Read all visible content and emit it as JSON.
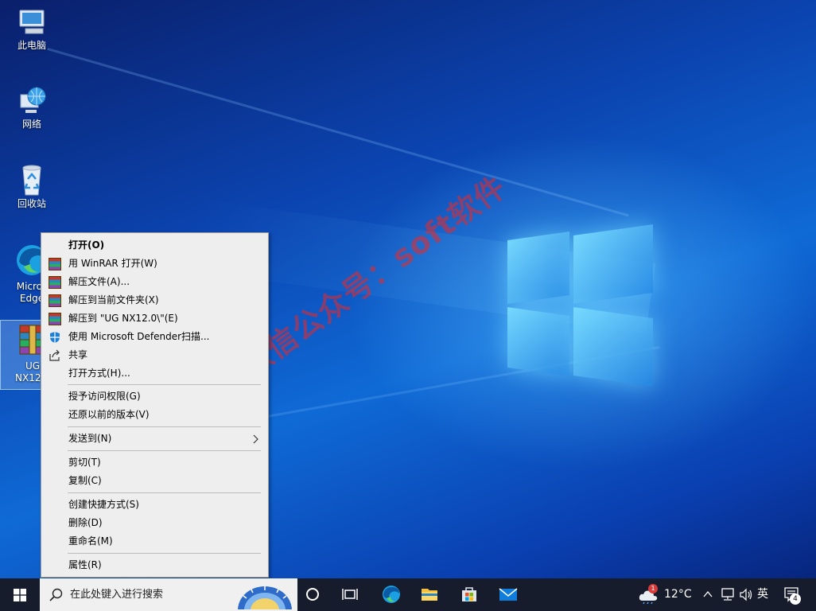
{
  "desktop": {
    "icons": [
      {
        "label": "此电脑",
        "icon": "computer-icon"
      },
      {
        "label": "网络",
        "icon": "network-globe-icon"
      },
      {
        "label": "回收站",
        "icon": "recycle-bin-icon"
      },
      {
        "label": "Micros\nEdge",
        "label_line1": "Micros",
        "label_line2": "Edge",
        "icon": "edge-browser-icon"
      },
      {
        "label_line1": "UG",
        "label_line2": "NX12.0",
        "icon": "winrar-archive-icon"
      }
    ],
    "watermark": "微信公众号：soft软件"
  },
  "context_menu": {
    "items": [
      {
        "label": "打开(O)",
        "bold": true,
        "icon": ""
      },
      {
        "label": "用 WinRAR 打开(W)",
        "icon": "winrar-icon"
      },
      {
        "label": "解压文件(A)...",
        "icon": "winrar-icon"
      },
      {
        "label": "解压到当前文件夹(X)",
        "icon": "winrar-icon"
      },
      {
        "label": "解压到 \"UG NX12.0\\\"(E)",
        "icon": "winrar-icon"
      },
      {
        "label": "使用 Microsoft Defender扫描...",
        "icon": "defender-shield-icon"
      },
      {
        "label": "共享",
        "icon": "share-icon"
      },
      {
        "label": "打开方式(H)...",
        "icon": ""
      },
      {
        "label": "授予访问权限(G)",
        "icon": ""
      },
      {
        "label": "还原以前的版本(V)",
        "icon": ""
      },
      {
        "label": "发送到(N)",
        "icon": "",
        "submenu": true
      },
      {
        "label": "剪切(T)",
        "icon": ""
      },
      {
        "label": "复制(C)",
        "icon": ""
      },
      {
        "label": "创建快捷方式(S)",
        "icon": ""
      },
      {
        "label": "删除(D)",
        "icon": ""
      },
      {
        "label": "重命名(M)",
        "icon": ""
      },
      {
        "label": "属性(R)",
        "icon": ""
      }
    ]
  },
  "taskbar": {
    "search_placeholder": "在此处键入进行搜索",
    "pinned_icons": [
      "cortana-circle-icon",
      "task-view-icon",
      "edge-icon",
      "file-explorer-icon",
      "microsoft-store-icon",
      "mail-icon"
    ],
    "weather_badge": "1",
    "temperature": "12°C",
    "ime_label": "英",
    "notification_count": "4",
    "accent_color": "#161c2b"
  }
}
